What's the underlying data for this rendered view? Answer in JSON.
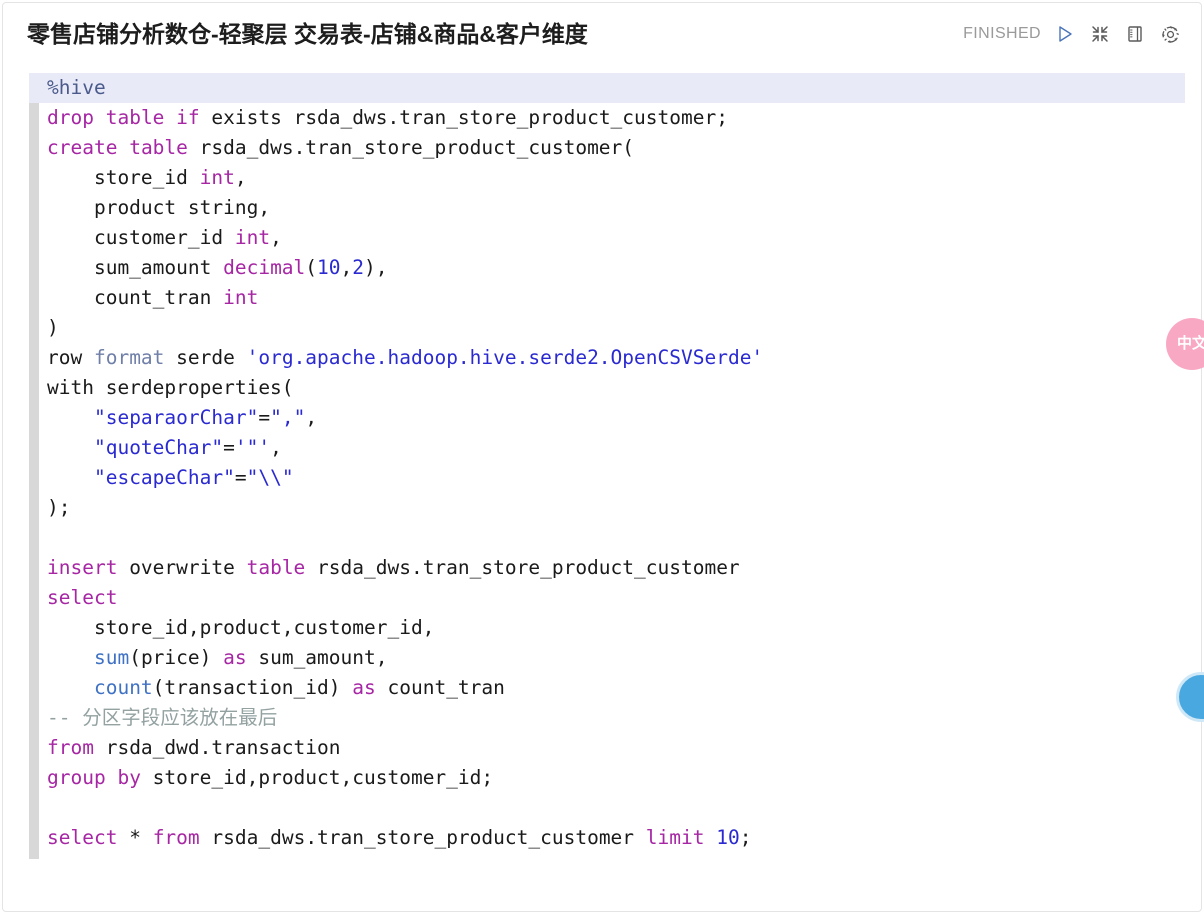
{
  "header": {
    "title": "零售店铺分析数仓-轻聚层 交易表-店铺&商品&客户维度",
    "status": "FINISHED",
    "icons": {
      "run": "play-icon",
      "collapse": "collapse-icon",
      "book": "notebook-icon",
      "settings": "gear-icon"
    }
  },
  "editor": {
    "interpreter": "%hive",
    "lines": [
      "%hive",
      "drop table if exists rsda_dws.tran_store_product_customer;",
      "create table rsda_dws.tran_store_product_customer(",
      "    store_id int,",
      "    product string,",
      "    customer_id int,",
      "    sum_amount decimal(10,2),",
      "    count_tran int",
      ")",
      "row format serde 'org.apache.hadoop.hive.serde2.OpenCSVSerde'",
      "with serdeproperties(",
      "    \"separaorChar\"=\",\",",
      "    \"quoteChar\"='\"',",
      "    \"escapeChar\"=\"\\\\\"",
      ");",
      "",
      "insert overwrite table rsda_dws.tran_store_product_customer",
      "select",
      "    store_id,product,customer_id,",
      "    sum(price) as sum_amount,",
      "    count(transaction_id) as count_tran",
      "-- 分区字段应该放在最后",
      "from rsda_dwd.transaction",
      "group by store_id,product,customer_id;",
      "",
      "select * from rsda_dws.tran_store_product_customer limit 10;"
    ],
    "tokens": {
      "magic": "%hive",
      "l1": {
        "kw1": "drop",
        "kw2": "table",
        "kw3": "if",
        "plain": " exists rsda_dws.tran_store_product_customer;"
      },
      "l2": {
        "kw1": "create",
        "kw2": "table",
        "plain": " rsda_dws.tran_store_product_customer("
      },
      "l3": {
        "name": "    store_id ",
        "type": "int",
        "tail": ","
      },
      "l4": {
        "name": "    product string,",
        "type": "",
        "tail": ""
      },
      "l5": {
        "name": "    customer_id ",
        "type": "int",
        "tail": ","
      },
      "l6": {
        "name": "    sum_amount ",
        "type": "decimal",
        "open": "(",
        "n1": "10",
        "c": ",",
        "n2": "2",
        "close": "),"
      },
      "l7": {
        "name": "    count_tran ",
        "type": "int",
        "tail": ""
      },
      "l8": {
        "plain": ")"
      },
      "l9": {
        "p1": "row ",
        "dim": "format",
        "p2": " serde ",
        "str": "'org.apache.hadoop.hive.serde2.OpenCSVSerde'"
      },
      "l10": {
        "plain": "with serdeproperties("
      },
      "l11": {
        "indent": "    ",
        "s1": "\"separaorChar\"",
        "eq": "=",
        "s2": "\",\"",
        "tail": ","
      },
      "l12": {
        "indent": "    ",
        "s1": "\"quoteChar\"",
        "eq": "=",
        "s2": "'\"'",
        "tail": ","
      },
      "l13": {
        "indent": "    ",
        "s1": "\"escapeChar\"",
        "eq": "=",
        "s2": "\"\\\\\"",
        "tail": ""
      },
      "l14": {
        "plain": ");"
      },
      "l15": {
        "kw1": "insert",
        "p1": " overwrite ",
        "kw2": "table",
        "p2": " rsda_dws.tran_store_product_customer"
      },
      "l16": {
        "kw1": "select"
      },
      "l17": {
        "plain": "    store_id,product,customer_id,"
      },
      "l18": {
        "indent": "    ",
        "fn": "sum",
        "args": "(price) ",
        "kw": "as",
        "tail": " sum_amount,"
      },
      "l19": {
        "indent": "    ",
        "fn": "count",
        "args": "(transaction_id) ",
        "kw": "as",
        "tail": " count_tran"
      },
      "l20": {
        "comment": "-- 分区字段应该放在最后"
      },
      "l21": {
        "kw1": "from",
        "plain": " rsda_dwd.transaction"
      },
      "l22": {
        "kw1": "group",
        "kw2": "by",
        "plain": " store_id,product,customer_id;"
      },
      "l23": {
        "kw1": "select",
        "star": " * ",
        "kw2": "from",
        "plain": " rsda_dws.tran_store_product_customer ",
        "kw3": "limit",
        "sp": " ",
        "num": "10",
        "semi": ";"
      }
    }
  },
  "widgets": {
    "feedback_label": "中文",
    "chat_label": ""
  },
  "colors": {
    "keyword": "#a626a4",
    "string": "#2a2ad0",
    "number": "#2a2ad0",
    "function": "#3f72c4",
    "comment": "#93a1a1",
    "magic_bg": "#e9eaf8",
    "accent_pink": "#f9a8c4",
    "accent_blue": "#4aa8e0",
    "icon_blue": "#4a74b8"
  }
}
